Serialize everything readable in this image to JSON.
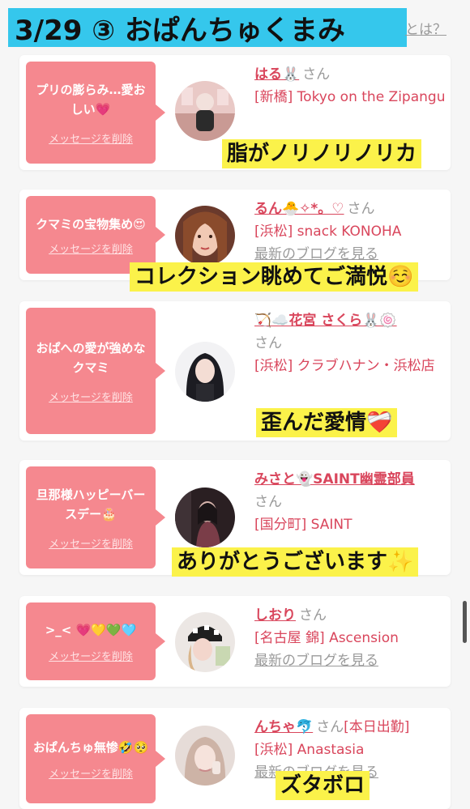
{
  "header": {
    "title": "3/29 ③ おぱんちゅくまみ",
    "link": "とは？"
  },
  "cards": [
    {
      "message": "プリの膨らみ…愛おしい💗",
      "delete_label": "メッセージを削除",
      "name": "はる🐰",
      "honorific": "さん",
      "shop": "[新橋] Tokyo on the Zipangu",
      "caption": "脂がノリノリノリカ"
    },
    {
      "message": "クマミの宝物集め😍",
      "delete_label": "メッセージを削除",
      "name": "るん🐣✧*。♡",
      "honorific": "さん",
      "shop": "[浜松] snack KONOHA",
      "blog": "最新のブログを見る",
      "caption": "コレクション眺めてご満悦☺️"
    },
    {
      "message": "おぱへの愛が強めなクマミ",
      "delete_label": "メッセージを削除",
      "name": "🏹☁️花宮 さくら🐰🍥",
      "honorific": "さん",
      "shop": "[浜松] クラブハナン・浜松店",
      "caption": "歪んだ愛情❤️‍🩹"
    },
    {
      "message": "旦那様ハッピーバースデー🎂",
      "delete_label": "メッセージを削除",
      "name": "みさと👻SAINT幽霊部員",
      "honorific": "さん",
      "shop": "[国分町] SAINT",
      "caption": "ありがとうございます✨"
    },
    {
      "message": ">_< 💗💛💚🩵",
      "delete_label": "メッセージを削除",
      "name": "しおり",
      "honorific": "さん",
      "shop": "[名古屋 錦] Ascension",
      "blog": "最新のブログを見る"
    },
    {
      "message": "おぱんちゅ無惨🤣🥺",
      "delete_label": "メッセージを削除",
      "name": "んちゃ🐬",
      "honorific": "さん",
      "extra": "[本日出勤]",
      "shop": "[浜松] Anastasia",
      "blog": "最新のブログを見る",
      "caption": "ズタボロ"
    }
  ]
}
